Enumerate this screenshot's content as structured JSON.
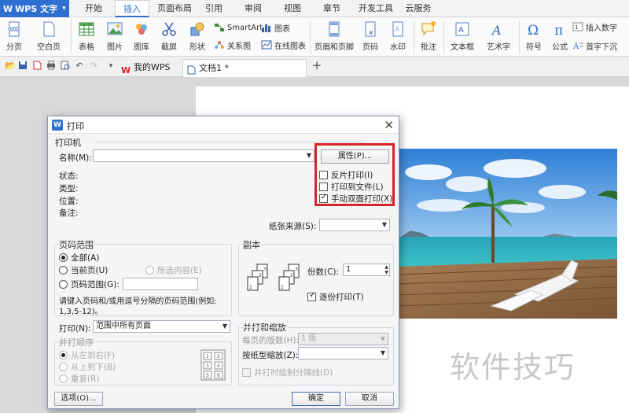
{
  "app": {
    "name": "WPS 文字"
  },
  "menu": [
    "开始",
    "插入",
    "页面布局",
    "引用",
    "审阅",
    "视图",
    "章节",
    "开发工具",
    "云服务"
  ],
  "ribbon": {
    "fenye": "分页",
    "kongbaiye": "空白页",
    "biaoge": "表格",
    "tupian": "图片",
    "tuku": "图库",
    "jietu": "截屏",
    "xingzhuang": "形状",
    "smartart": "SmartArt",
    "tubiao": "图表",
    "guanxitu": "关系图",
    "zaixiantubiao": "在线图表",
    "yemeiheyejiao": "页眉和页脚",
    "yema": "页码",
    "shuiyin": "水印",
    "pizhu": "批注",
    "wenbenkuang": "文本框",
    "yishuzi": "艺术字",
    "fuhao": "符号",
    "gongshi": "公式",
    "charushuzi": "插入数字",
    "shouzixiachen": "首字下沉"
  },
  "tabs": {
    "mywps": "我的WPS",
    "doc": "文档1 *"
  },
  "watermark": "软件技巧",
  "dialog": {
    "title": "打印",
    "printer_group": "打印机",
    "name_label": "名称(M):",
    "properties_btn": "属性(P)...",
    "reverse_print": "反片打印(I)",
    "print_to_file": "打印到文件(L)",
    "manual_duplex": "手动双面打印(X)",
    "status_label": "状态:",
    "type_label": "类型:",
    "location_label": "位置:",
    "comment_label": "备注:",
    "paper_source_label": "纸张来源(S):",
    "page_range_group": "页码范围",
    "all_label": "全部(A)",
    "current_page_label": "当前页(U)",
    "selection_label": "所选内容(E)",
    "pages_label": "页码范围(G):",
    "pages_hint": "请键入页码和/或用逗号分隔的页码范围(例如:",
    "pages_hint2": "1,3,5-12)。",
    "copies_group": "副本",
    "copies_label": "份数(C):",
    "copies_value": "1",
    "collate_label": "逐份打印(T)",
    "print_label": "打印(N):",
    "print_value": "范围中所有页面",
    "pages_per_sheet_group": "并打顺序",
    "left_to_right": "从左到右(F)",
    "top_to_bottom": "从上到下(B)",
    "repeat": "重复(R)",
    "zoom_group": "并打和缩放",
    "pages_per_sheet_label": "每页的版数(H):",
    "pages_per_sheet_value": "1 版",
    "scale_label": "按纸型缩放(Z):",
    "draw_lines_label": "并打时绘制分隔线(D)",
    "options_btn": "选项(O)...",
    "ok_btn": "确定",
    "cancel_btn": "取消"
  }
}
